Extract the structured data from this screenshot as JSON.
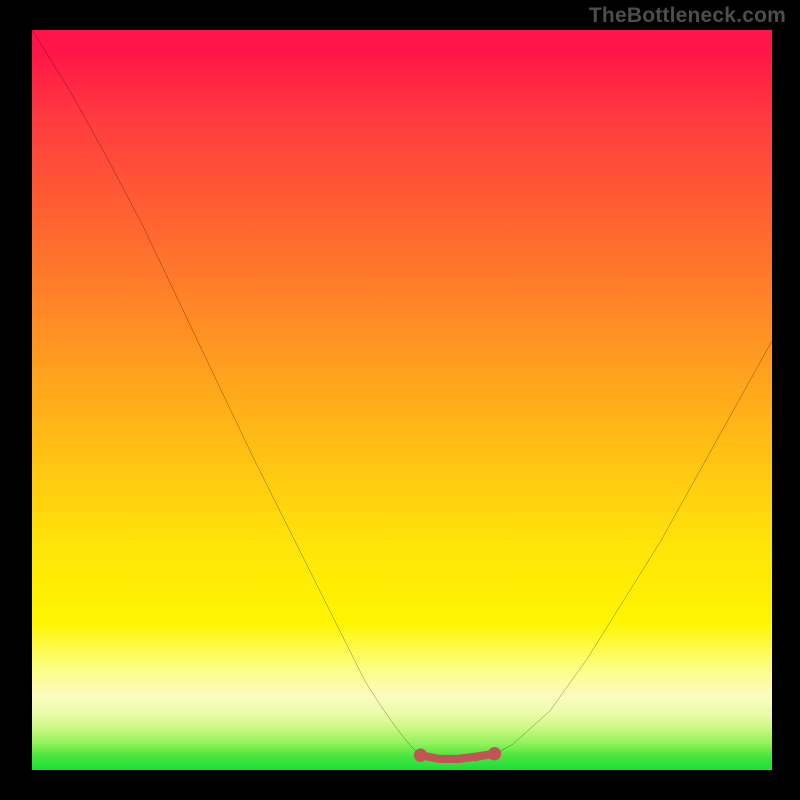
{
  "watermark": "TheBottleneck.com",
  "chart_data": {
    "type": "line",
    "title": "",
    "xlabel": "",
    "ylabel": "",
    "xlim": [
      0,
      100
    ],
    "ylim": [
      0,
      100
    ],
    "series": [
      {
        "name": "bottleneck-curve",
        "x": [
          0,
          5,
          10,
          15,
          20,
          25,
          30,
          35,
          40,
          45,
          50,
          52.5,
          55,
          57.5,
          60,
          62.5,
          65,
          70,
          75,
          80,
          85,
          90,
          95,
          100
        ],
        "values": [
          100,
          92,
          83,
          73.5,
          63,
          52.5,
          42,
          32,
          22,
          12,
          4,
          2,
          1.5,
          1.5,
          1.5,
          2,
          3.5,
          8,
          15,
          23,
          31,
          40,
          49,
          58
        ]
      },
      {
        "name": "flat-segment-marker",
        "x": [
          52.5,
          55,
          57.5,
          60,
          62.5
        ],
        "values": [
          2.0,
          1.5,
          1.5,
          1.8,
          2.2
        ]
      }
    ],
    "annotations": [],
    "background_gradient": {
      "top_color": "#ff1547",
      "mid_color": "#fff500",
      "bottom_color": "#18df3a"
    }
  }
}
